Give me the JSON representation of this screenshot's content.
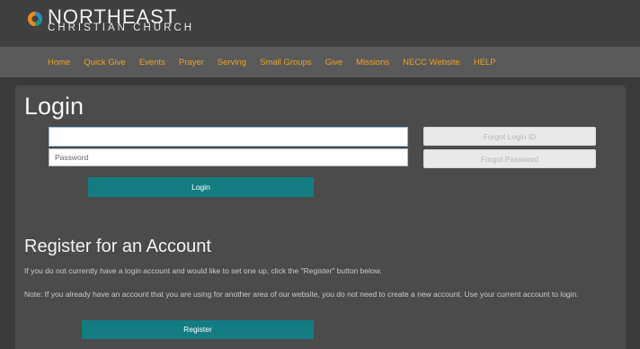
{
  "brand": {
    "name_top": "NORTHEAST",
    "name_bottom": "CHRISTIAN CHURCH",
    "colors": {
      "orange": "#e98b23",
      "blue": "#2e87c8",
      "teal": "#1a9a7e"
    }
  },
  "nav": {
    "items": [
      {
        "label": "Home"
      },
      {
        "label": "Quick Give"
      },
      {
        "label": "Events"
      },
      {
        "label": "Prayer"
      },
      {
        "label": "Serving"
      },
      {
        "label": "Small Groups"
      },
      {
        "label": "Give"
      },
      {
        "label": "Missions"
      },
      {
        "label": "NECC Website"
      },
      {
        "label": "HELP"
      }
    ],
    "link_color": "#e6a22b"
  },
  "login": {
    "title": "Login",
    "userid_value": "",
    "password_placeholder": "Password",
    "forgot_id_label": "Forgot Login ID",
    "forgot_password_label": "Forgot Password",
    "submit_label": "Login"
  },
  "register": {
    "title": "Register for an Account",
    "text1": "If you do not currently have a login account and would like to set one up, click the \"Register\" button below.",
    "text2": "Note: If you already have an account that you are using for another area of our website, you do not need to create a new account. Use your current account to login.",
    "button_label": "Register"
  },
  "theme": {
    "button_teal": "#137d82",
    "panel": "#4b4b4b",
    "nav_bar": "#5a5a5a"
  }
}
